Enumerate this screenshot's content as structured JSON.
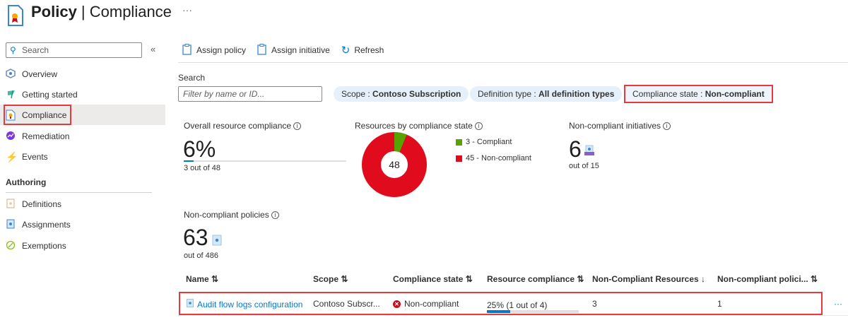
{
  "header": {
    "title_bold": "Policy",
    "title_rest": " | Compliance",
    "more": "···"
  },
  "sidebar": {
    "search_placeholder": "Search",
    "collapse": "«",
    "items": [
      {
        "label": "Overview",
        "icon": "overview-icon"
      },
      {
        "label": "Getting started",
        "icon": "flag-icon"
      },
      {
        "label": "Compliance",
        "icon": "compliance-icon",
        "selected": true
      },
      {
        "label": "Remediation",
        "icon": "remediation-icon"
      },
      {
        "label": "Events",
        "icon": "lightning-icon"
      }
    ],
    "section": "Authoring",
    "authoring": [
      {
        "label": "Definitions",
        "icon": "definitions-icon"
      },
      {
        "label": "Assignments",
        "icon": "assignments-icon"
      },
      {
        "label": "Exemptions",
        "icon": "exemptions-icon"
      }
    ]
  },
  "toolbar": {
    "assign_policy": "Assign policy",
    "assign_initiative": "Assign initiative",
    "refresh": "Refresh"
  },
  "filters": {
    "search_label": "Search",
    "search_placeholder": "Filter by name or ID...",
    "scope_label": "Scope : ",
    "scope_value": "Contoso Subscription",
    "deftype_label": "Definition type : ",
    "deftype_value": "All definition types",
    "state_label": "Compliance state : ",
    "state_value": "Non-compliant"
  },
  "stats": {
    "overall": {
      "title": "Overall resource compliance",
      "value": "6%",
      "sub": "3 out of 48",
      "percent": 6
    },
    "by_state": {
      "title": "Resources by compliance state",
      "total": "48",
      "compliant": 3,
      "noncompliant": 45,
      "compliant_label": "3 - Compliant",
      "noncompliant_label": "45 - Non-compliant",
      "compliant_color": "#57a300",
      "noncompliant_color": "#e00b1c"
    },
    "initiatives": {
      "title": "Non-compliant initiatives",
      "value": "6",
      "sub": "out of 15"
    },
    "policies": {
      "title": "Non-compliant policies",
      "value": "63",
      "sub": "out of 486"
    }
  },
  "table": {
    "headers": [
      "Name ⇅",
      "Scope ⇅",
      "Compliance state ⇅",
      "Resource compliance ⇅",
      "Non-Compliant Resources ↓",
      "Non-compliant polici... ⇅"
    ],
    "rows": [
      {
        "name": "Audit flow logs configuration",
        "scope": "Contoso Subscr...",
        "state": "Non-compliant",
        "resource_compliance": "25% (1 out of 4)",
        "percent": 25,
        "noncompliant_resources": "3",
        "noncompliant_policies": "1",
        "more": "···"
      }
    ]
  }
}
